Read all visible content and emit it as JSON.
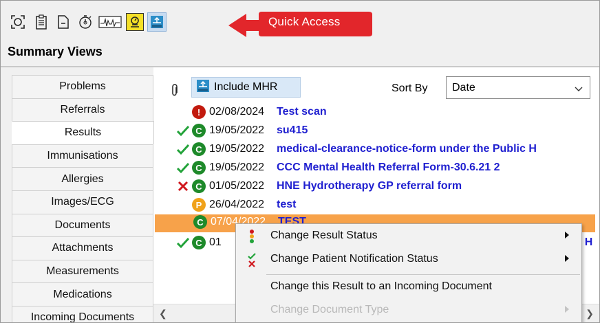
{
  "toolbar": {
    "buttons": [
      {
        "icon": "scan-icon"
      },
      {
        "icon": "clipboard-icon"
      },
      {
        "icon": "document-icon"
      },
      {
        "icon": "stopwatch-icon"
      },
      {
        "icon": "ecg-icon"
      },
      {
        "icon": "weight-scale-icon"
      },
      {
        "icon": "mhr-icon"
      }
    ],
    "callout_text": "Quick Access",
    "callout_color": "#e2262b"
  },
  "section_title": "Summary Views",
  "nav": {
    "items": [
      {
        "label": "Problems"
      },
      {
        "label": "Referrals"
      },
      {
        "label": "Results",
        "active": true
      },
      {
        "label": "Immunisations"
      },
      {
        "label": "Allergies"
      },
      {
        "label": "Images/ECG"
      },
      {
        "label": "Documents"
      },
      {
        "label": "Attachments"
      },
      {
        "label": "Measurements"
      },
      {
        "label": "Medications"
      },
      {
        "label": "Incoming Documents"
      }
    ]
  },
  "results": {
    "include_mhr_label": "Include MHR",
    "sort_by_label": "Sort By",
    "sort_value": "Date",
    "rows": [
      {
        "tick": "",
        "status": "!",
        "status_color": "#c21a0e",
        "date": "02/08/2024",
        "title": "Test scan"
      },
      {
        "tick": "check",
        "status": "C",
        "status_color": "#1e8a2a",
        "date": "19/05/2022",
        "title": "su415"
      },
      {
        "tick": "check",
        "status": "C",
        "status_color": "#1e8a2a",
        "date": "19/05/2022",
        "title": "medical-clearance-notice-form under the Public H"
      },
      {
        "tick": "check",
        "status": "C",
        "status_color": "#1e8a2a",
        "date": "19/05/2022",
        "title": "CCC Mental Health Referral Form-30.6.21 2"
      },
      {
        "tick": "cross",
        "status": "C",
        "status_color": "#1e8a2a",
        "date": "01/05/2022",
        "title": "HNE Hydrotherapy GP referral form"
      },
      {
        "tick": "",
        "status": "P",
        "status_color": "#f0a21a",
        "date": "26/04/2022",
        "title": "test"
      },
      {
        "tick": "",
        "status": "C",
        "status_color": "#1e8a2a",
        "date": "07/04/2022",
        "title": "TEST",
        "selected": true
      },
      {
        "tick": "check",
        "status": "C",
        "status_color": "#1e8a2a",
        "date": "01",
        "title": ": H"
      }
    ]
  },
  "context_menu": {
    "items": [
      {
        "label": "Change Result Status",
        "icon": "traffic-light-icon",
        "submenu": true,
        "disabled": false
      },
      {
        "label": "Change Patient Notification Status",
        "icon": "check-cross-icon",
        "submenu": true,
        "disabled": false
      },
      {
        "label": "Change this Result to an Incoming Document",
        "icon": "",
        "submenu": false,
        "disabled": false
      },
      {
        "label": "Change Document Type",
        "icon": "",
        "submenu": true,
        "disabled": true
      }
    ]
  },
  "colors": {
    "selected_row": "#f7a24a",
    "link_blue": "#1f1fd0",
    "tick_green": "#23a33a",
    "cross_red": "#d0161c"
  }
}
